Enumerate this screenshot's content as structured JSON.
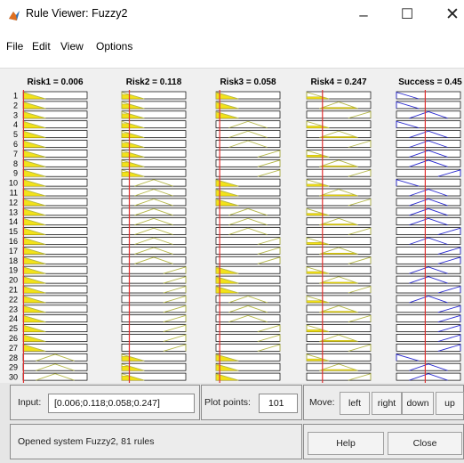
{
  "window": {
    "title": "Rule Viewer: Fuzzy2"
  },
  "titlebar": {
    "minimize_glyph": "–",
    "maximize_glyph": "☐",
    "close_glyph": "✕"
  },
  "menu": {
    "items": [
      "File",
      "Edit",
      "View",
      "Options"
    ]
  },
  "rule_viewer": {
    "columns": [
      {
        "label": "Risk1 = 0.006",
        "value": 0.006
      },
      {
        "label": "Risk2 = 0.118",
        "value": 0.118
      },
      {
        "label": "Risk3 = 0.058",
        "value": 0.058
      },
      {
        "label": "Risk4 = 0.247",
        "value": 0.247
      },
      {
        "label": "Success = 0.45",
        "value": 0.45
      }
    ],
    "rule_numbers": [
      "1",
      "2",
      "3",
      "4",
      "5",
      "6",
      "7",
      "8",
      "9",
      "10",
      "11",
      "12",
      "13",
      "14",
      "15",
      "16",
      "17",
      "18",
      "19",
      "20",
      "21",
      "22",
      "23",
      "24",
      "25",
      "26",
      "27",
      "28",
      "29",
      "30"
    ],
    "membership_sets": {
      "low": [
        0.0,
        0.0,
        0.35
      ],
      "medium": [
        0.2,
        0.5,
        0.8
      ],
      "high": [
        0.65,
        1.0,
        1.0
      ]
    },
    "rule_antecedents": [
      [
        "low",
        "low",
        "low",
        "low"
      ],
      [
        "low",
        "low",
        "low",
        "medium"
      ],
      [
        "low",
        "low",
        "low",
        "high"
      ],
      [
        "low",
        "low",
        "medium",
        "low"
      ],
      [
        "low",
        "low",
        "medium",
        "medium"
      ],
      [
        "low",
        "low",
        "medium",
        "high"
      ],
      [
        "low",
        "low",
        "high",
        "low"
      ],
      [
        "low",
        "low",
        "high",
        "medium"
      ],
      [
        "low",
        "low",
        "high",
        "high"
      ],
      [
        "low",
        "medium",
        "low",
        "low"
      ],
      [
        "low",
        "medium",
        "low",
        "medium"
      ],
      [
        "low",
        "medium",
        "low",
        "high"
      ],
      [
        "low",
        "medium",
        "medium",
        "low"
      ],
      [
        "low",
        "medium",
        "medium",
        "medium"
      ],
      [
        "low",
        "medium",
        "medium",
        "high"
      ],
      [
        "low",
        "medium",
        "high",
        "low"
      ],
      [
        "low",
        "medium",
        "high",
        "medium"
      ],
      [
        "low",
        "medium",
        "high",
        "high"
      ],
      [
        "low",
        "high",
        "low",
        "low"
      ],
      [
        "low",
        "high",
        "low",
        "medium"
      ],
      [
        "low",
        "high",
        "low",
        "high"
      ],
      [
        "low",
        "high",
        "medium",
        "low"
      ],
      [
        "low",
        "high",
        "medium",
        "medium"
      ],
      [
        "low",
        "high",
        "medium",
        "high"
      ],
      [
        "low",
        "high",
        "high",
        "low"
      ],
      [
        "low",
        "high",
        "high",
        "medium"
      ],
      [
        "low",
        "high",
        "high",
        "high"
      ],
      [
        "medium",
        "low",
        "low",
        "low"
      ],
      [
        "medium",
        "low",
        "low",
        "medium"
      ],
      [
        "medium",
        "low",
        "low",
        "high"
      ]
    ],
    "rule_consequents": [
      "low",
      "low",
      "medium",
      "low",
      "medium",
      "medium",
      "medium",
      "medium",
      "high",
      "low",
      "medium",
      "medium",
      "medium",
      "medium",
      "high",
      "medium",
      "high",
      "high",
      "medium",
      "medium",
      "high",
      "medium",
      "high",
      "high",
      "high",
      "high",
      "high",
      "low",
      "medium",
      "medium"
    ],
    "colors": {
      "input_mf": "#b5b84a",
      "input_fill": "#f2e21a",
      "output_mf": "#2a2ad0",
      "indicator": "#e03030",
      "box_border": "#000000"
    }
  },
  "controls": {
    "input_label": "Input:",
    "input_value": "[0.006;0.118;0.058;0.247]",
    "plot_points_label": "Plot points:",
    "plot_points_value": "101",
    "move_label": "Move:",
    "move_buttons": [
      "left",
      "right",
      "down",
      "up"
    ],
    "status_text": "Opened system Fuzzy2, 81 rules",
    "help_label": "Help",
    "close_label": "Close"
  }
}
